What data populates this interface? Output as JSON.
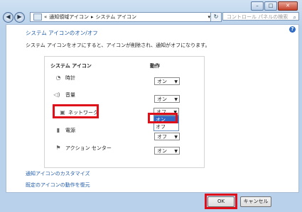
{
  "window": {
    "minimize_label": "–",
    "maximize_label": "□",
    "close_label": "✕"
  },
  "nav": {
    "back_label": "◀",
    "forward_label": "▶",
    "breadcrumb_root": "«",
    "breadcrumb_1": "通知領域アイコン",
    "breadcrumb_sep": "▸",
    "breadcrumb_2": "システム アイコン",
    "breadcrumb_dropdown": "▾",
    "refresh_label": "↻",
    "search_placeholder": "コントロール パネルの検索"
  },
  "page": {
    "help_label": "?",
    "heading": "システム アイコンのオン/オフ",
    "description": "システム アイコンをオフにすると、アイコンが削除され、通知がオフになります。",
    "col_icon": "システム アイコン",
    "col_action": "動作"
  },
  "icons": [
    {
      "name": "時計",
      "icon": "clock-icon",
      "glyph": "◔",
      "value": "オン"
    },
    {
      "name": "音量",
      "icon": "speaker-icon",
      "glyph": "◁)",
      "value": "オン"
    },
    {
      "name": "ネットワーク",
      "icon": "network-icon",
      "glyph": "▣",
      "value": "オフ"
    },
    {
      "name": "電源",
      "icon": "battery-icon",
      "glyph": "▮",
      "value": "オン"
    },
    {
      "name": "アクション センター",
      "icon": "flag-icon",
      "glyph": "⚑",
      "value": "オン"
    }
  ],
  "dropdown_open": {
    "options": [
      "オン",
      "オフ"
    ],
    "selected": "オン"
  },
  "links": {
    "customize": "通知アイコンのカスタマイズ",
    "restore": "既定のアイコンの動作を復元"
  },
  "buttons": {
    "ok": "OK",
    "cancel": "キャンセル"
  },
  "colors": {
    "highlight": "#e0101a",
    "link": "#1d5aa8",
    "selection": "#316ac5"
  }
}
